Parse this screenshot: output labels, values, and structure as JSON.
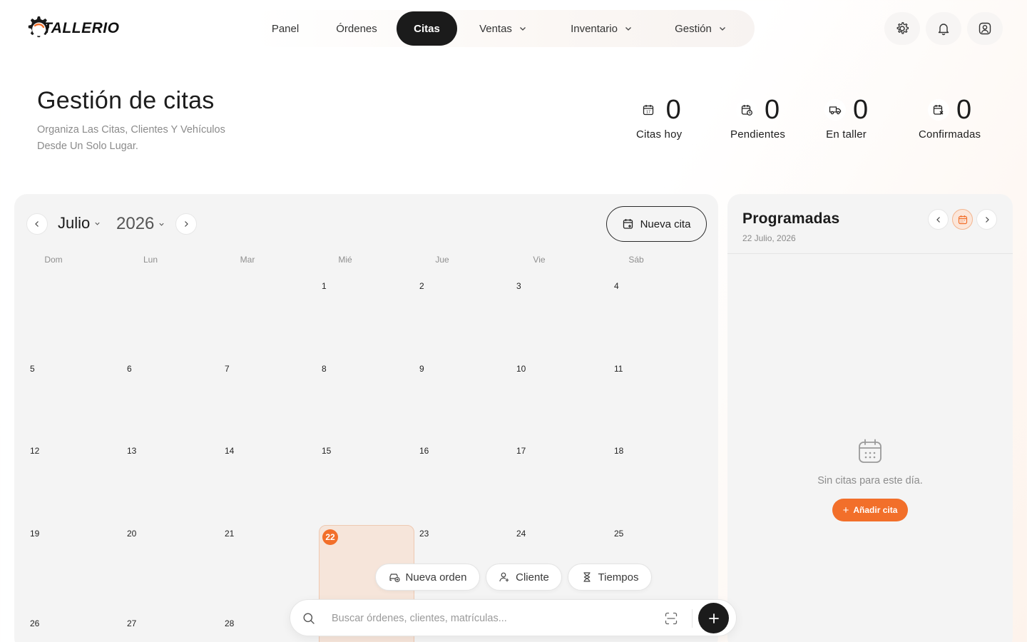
{
  "brand": {
    "name": "TALLERIO",
    "accent": "#f26f2a"
  },
  "nav": {
    "items": [
      {
        "label": "Panel",
        "active": false,
        "dropdown": false
      },
      {
        "label": "Órdenes",
        "active": false,
        "dropdown": false
      },
      {
        "label": "Citas",
        "active": true,
        "dropdown": false
      },
      {
        "label": "Ventas",
        "active": false,
        "dropdown": true
      },
      {
        "label": "Inventario",
        "active": false,
        "dropdown": true
      },
      {
        "label": "Gestión",
        "active": false,
        "dropdown": true
      }
    ]
  },
  "header_actions": [
    "settings-icon",
    "bell-icon",
    "user-icon"
  ],
  "page": {
    "title": "Gestión de citas",
    "subtitle": "Organiza Las Citas, Clientes Y Vehículos Desde Un Solo Lugar."
  },
  "stats": [
    {
      "value": "0",
      "label": "Citas hoy",
      "icon": "calendar-day-icon"
    },
    {
      "value": "0",
      "label": "Pendientes",
      "icon": "calendar-clock-icon"
    },
    {
      "value": "0",
      "label": "En taller",
      "icon": "truck-icon"
    },
    {
      "value": "0",
      "label": "Confirmadas",
      "icon": "calendar-check-icon"
    }
  ],
  "calendar": {
    "month": "Julio",
    "year": "2026",
    "new_button": "Nueva cita",
    "weekdays": [
      "Dom",
      "Lun",
      "Mar",
      "Mié",
      "Jue",
      "Vie",
      "Sáb"
    ],
    "first_weekday_index": 3,
    "days_visible": 28,
    "today": "22"
  },
  "side": {
    "title": "Programadas",
    "date": "22 Julio, 2026",
    "empty_text": "Sin citas para este día.",
    "add_button": "Añadir cita"
  },
  "quick_actions": [
    {
      "label": "Nueva orden",
      "icon": "car-plus-icon"
    },
    {
      "label": "Cliente",
      "icon": "user-plus-icon"
    },
    {
      "label": "Tiempos",
      "icon": "hourglass-icon"
    }
  ],
  "search": {
    "placeholder": "Buscar órdenes, clientes, matrículas..."
  }
}
